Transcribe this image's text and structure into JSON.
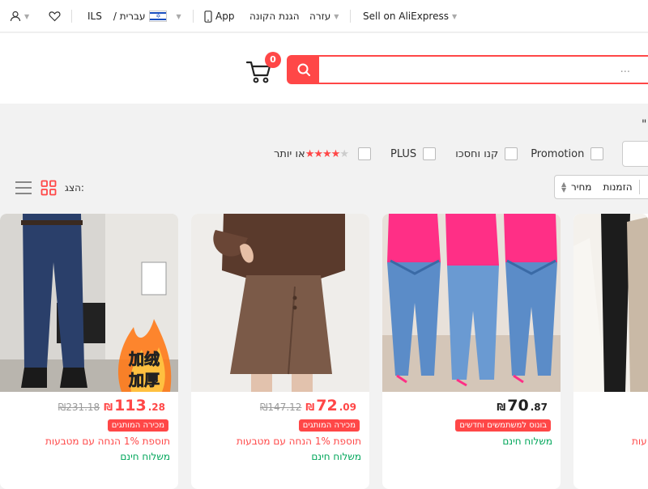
{
  "topbar": {
    "sell": "Sell on AliExpress",
    "help": "עזרה",
    "buyer_protection": "הגנת הקונה",
    "app": "App",
    "language": "/ עברית",
    "currency": "ILS"
  },
  "header": {
    "search_placeholder": "...",
    "cart_count": "0"
  },
  "quote_char": "\"",
  "filters": {
    "promotion": "Promotion",
    "buy_save": "קנו וחסכו",
    "plus": "PLUS",
    "rating_suffix": "או יותר"
  },
  "sort": {
    "orders": "הזמנות",
    "price": "מחיר"
  },
  "view": {
    "label": "הצג:"
  },
  "products": [
    {
      "currency": "₪",
      "price_int": "113",
      "price_dec": ".28",
      "old_price": "₪231.18",
      "badge": "מכירה המותגים",
      "promo": "תוספת 1% הנחה עם מטבעות",
      "shipping": "משלוח חינם",
      "overlay_text": "加绒\n加厚"
    },
    {
      "currency": "₪",
      "price_int": "72",
      "price_dec": ".09",
      "old_price": "₪147.12",
      "badge": "מכירה המותגים",
      "promo": "תוספת 1% הנחה עם מטבעות",
      "shipping": "משלוח חינם"
    },
    {
      "currency": "₪",
      "price_int": "70",
      "price_dec": ".87",
      "badge": "בונוס למשתמשים וחדשים",
      "shipping": "משלוח חינם"
    },
    {
      "promo": "עות"
    }
  ],
  "colors": {
    "accent": "#ff4747",
    "shipping": "#00a65a"
  }
}
